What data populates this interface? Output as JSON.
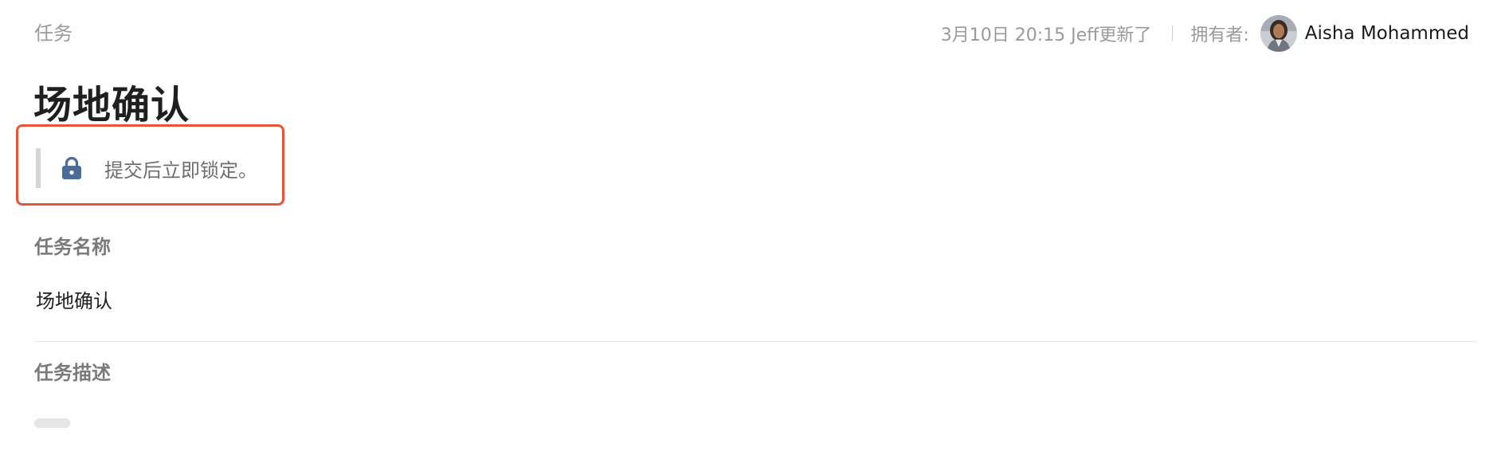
{
  "breadcrumb": {
    "label": "任务"
  },
  "header": {
    "updated_text": "3月10日 20:15 Jeff更新了",
    "owner_label": "拥有者:",
    "owner_name": "Aisha Mohammed"
  },
  "page": {
    "title": "场地确认"
  },
  "notice": {
    "icon": "lock-icon",
    "text": "提交后立即锁定。",
    "icon_color": "#4a6c96",
    "highlight_color": "#e4553a"
  },
  "fields": {
    "name": {
      "label": "任务名称",
      "value": "场地确认"
    },
    "description": {
      "label": "任务描述"
    }
  }
}
